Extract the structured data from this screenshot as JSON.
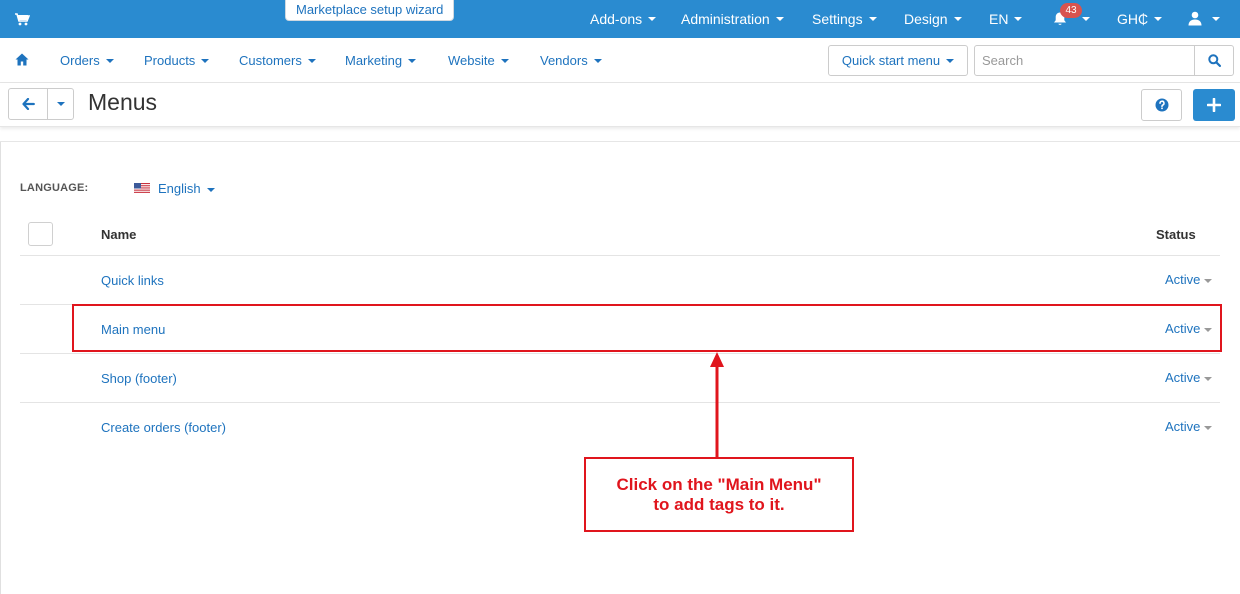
{
  "topbar": {
    "wizard_label": "Marketplace setup wizard",
    "menus": [
      {
        "label": "Add-ons"
      },
      {
        "label": "Administration"
      },
      {
        "label": "Settings"
      },
      {
        "label": "Design"
      },
      {
        "label": "EN"
      },
      {
        "label": "GH₵"
      }
    ],
    "notifications_count": "43",
    "bar_color": "#2a8bd0"
  },
  "subnav": {
    "items": [
      {
        "label": "Orders"
      },
      {
        "label": "Products"
      },
      {
        "label": "Customers"
      },
      {
        "label": "Marketing"
      },
      {
        "label": "Website"
      },
      {
        "label": "Vendors"
      }
    ],
    "quick_start_label": "Quick start menu",
    "search_placeholder": "Search"
  },
  "page": {
    "title": "Menus"
  },
  "content": {
    "language_label": "LANGUAGE:",
    "language_value": "English",
    "columns": {
      "name": "Name",
      "status": "Status"
    },
    "rows": [
      {
        "name": "Quick links",
        "status": "Active"
      },
      {
        "name": "Main menu",
        "status": "Active"
      },
      {
        "name": "Shop (footer)",
        "status": "Active"
      },
      {
        "name": "Create orders (footer)",
        "status": "Active"
      }
    ]
  },
  "annotation": {
    "line1": "Click on the \"Main Menu\"",
    "line2": "to add tags to it.",
    "color": "#e0151d"
  }
}
